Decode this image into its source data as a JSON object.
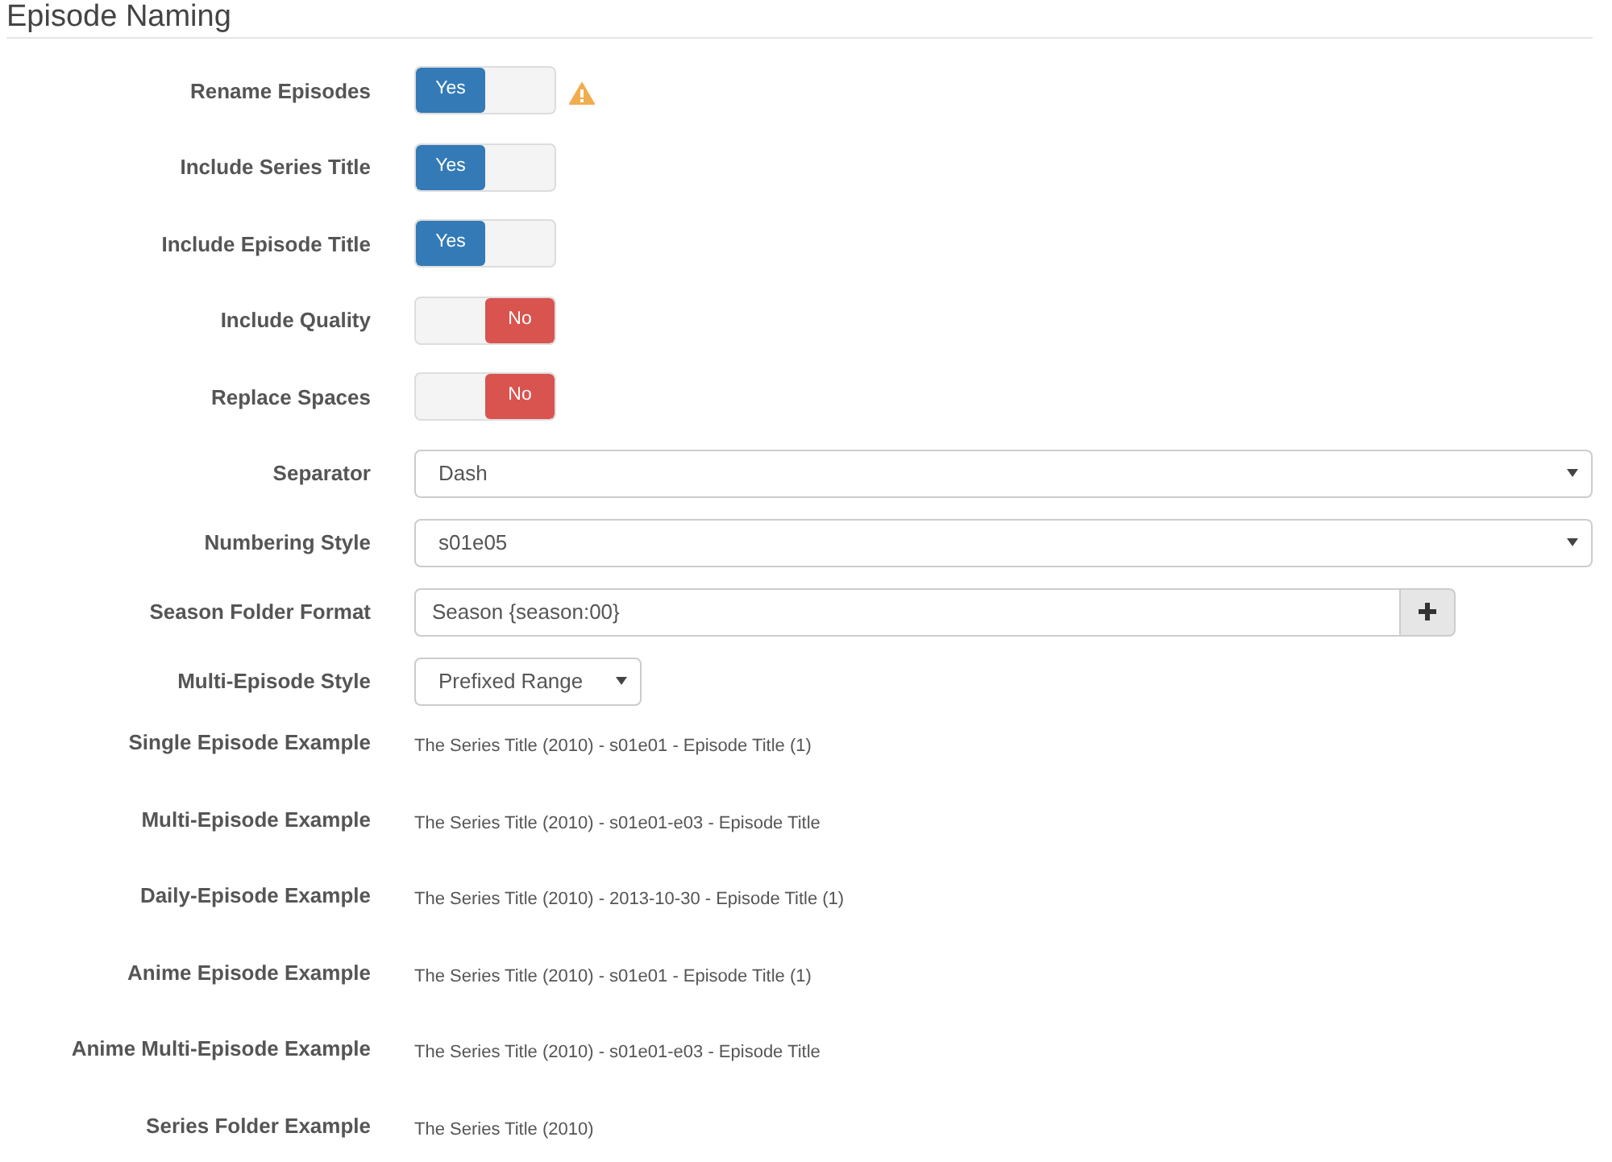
{
  "section": {
    "title": "Episode Naming"
  },
  "toggles": [
    {
      "label": "Rename Episodes",
      "on": true,
      "text": "Yes",
      "warning": true
    },
    {
      "label": "Include Series Title",
      "on": true,
      "text": "Yes",
      "warning": false
    },
    {
      "label": "Include Episode Title",
      "on": true,
      "text": "Yes",
      "warning": false
    },
    {
      "label": "Include Quality",
      "on": false,
      "text": "No",
      "warning": false
    },
    {
      "label": "Replace Spaces",
      "on": false,
      "text": "No",
      "warning": false
    }
  ],
  "inputs": [
    {
      "kind": "select",
      "label": "Separator",
      "value": "Dash"
    },
    {
      "kind": "select",
      "label": "Numbering Style",
      "value": "s01e05"
    },
    {
      "kind": "addon",
      "label": "Season Folder Format",
      "value": "Season {season:00}"
    },
    {
      "kind": "dropdown",
      "label": "Multi-Episode Style",
      "value": "Prefixed Range"
    }
  ],
  "examples": [
    {
      "label": "Single Episode Example",
      "value": "The Series Title (2010) - s01e01 - Episode Title (1)"
    },
    {
      "label": "Multi-Episode Example",
      "value": "The Series Title (2010) - s01e01-e03 - Episode Title"
    },
    {
      "label": "Daily-Episode Example",
      "value": "The Series Title (2010) - 2013-10-30 - Episode Title (1)"
    },
    {
      "label": "Anime Episode Example",
      "value": "The Series Title (2010) - s01e01 - Episode Title (1)"
    },
    {
      "label": "Anime Multi-Episode Example",
      "value": "The Series Title (2010) - s01e01-e03 - Episode Title"
    },
    {
      "label": "Series Folder Example",
      "value": "The Series Title (2010)"
    }
  ]
}
